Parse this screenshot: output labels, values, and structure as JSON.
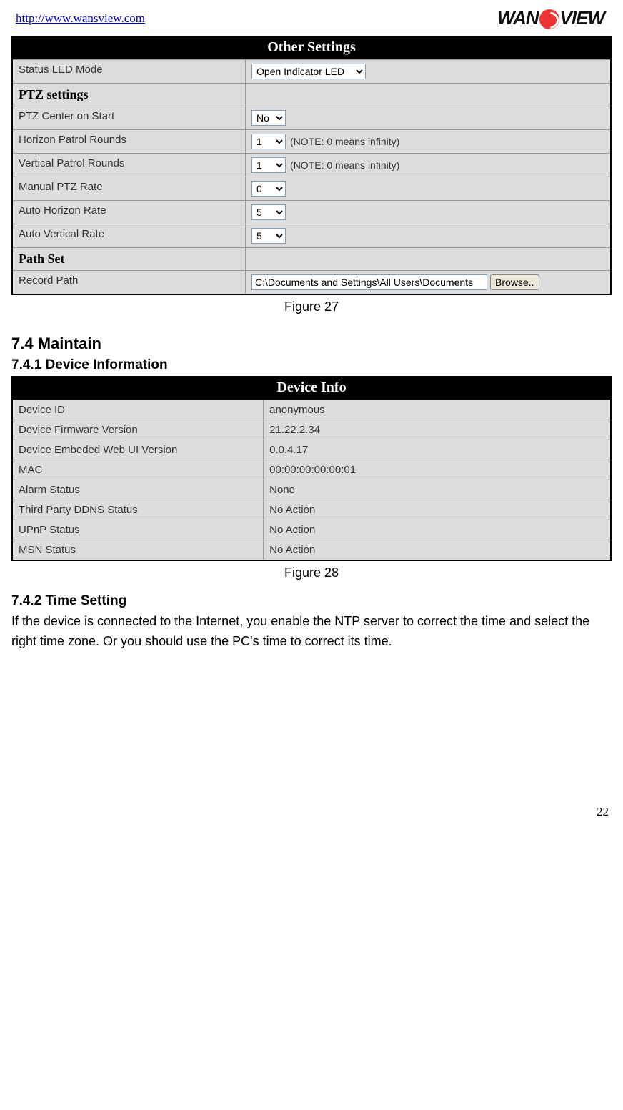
{
  "header": {
    "url": "http://www.wansview.com",
    "logo_text_left": "WAN",
    "logo_text_right": "VIEW"
  },
  "figure27": {
    "panel_title": "Other Settings",
    "caption": "Figure 27",
    "rows": {
      "status_led": {
        "label": "Status LED Mode",
        "value": "Open Indicator LED"
      },
      "ptz_section": "PTZ settings",
      "ptz_center": {
        "label": "PTZ Center on Start",
        "value": "No"
      },
      "horizon_patrol": {
        "label": "Horizon Patrol Rounds",
        "value": "1",
        "note": "(NOTE: 0 means infinity)"
      },
      "vertical_patrol": {
        "label": "Vertical Patrol Rounds",
        "value": "1",
        "note": "(NOTE: 0 means infinity)"
      },
      "manual_rate": {
        "label": "Manual PTZ Rate",
        "value": "0"
      },
      "auto_horizon_rate": {
        "label": "Auto Horizon Rate",
        "value": "5"
      },
      "auto_vertical_rate": {
        "label": "Auto Vertical Rate",
        "value": "5"
      },
      "path_section": "Path Set",
      "record_path": {
        "label": "Record Path",
        "value": "C:\\Documents and Settings\\All Users\\Documents",
        "button": "Browse.."
      }
    }
  },
  "section74": {
    "heading": "7.4  Maintain",
    "sub741": "7.4.1  Device Information"
  },
  "figure28": {
    "panel_title": "Device Info",
    "caption": "Figure 28",
    "rows": [
      {
        "label": "Device ID",
        "value": "anonymous"
      },
      {
        "label": "Device Firmware Version",
        "value": "21.22.2.34"
      },
      {
        "label": "Device Embeded Web UI Version",
        "value": "0.0.4.17"
      },
      {
        "label": "MAC",
        "value": "00:00:00:00:00:01"
      },
      {
        "label": "Alarm Status",
        "value": "None"
      },
      {
        "label": "Third Party DDNS Status",
        "value": "No Action"
      },
      {
        "label": "UPnP Status",
        "value": "No Action"
      },
      {
        "label": "MSN Status",
        "value": "No Action"
      }
    ]
  },
  "section742": {
    "heading": "7.4.2  Time Setting",
    "body": "If the device is connected to the Internet, you enable the NTP server to correct the time and select the right time zone. Or you should use the PC's time to correct its time."
  },
  "page_number": "22"
}
